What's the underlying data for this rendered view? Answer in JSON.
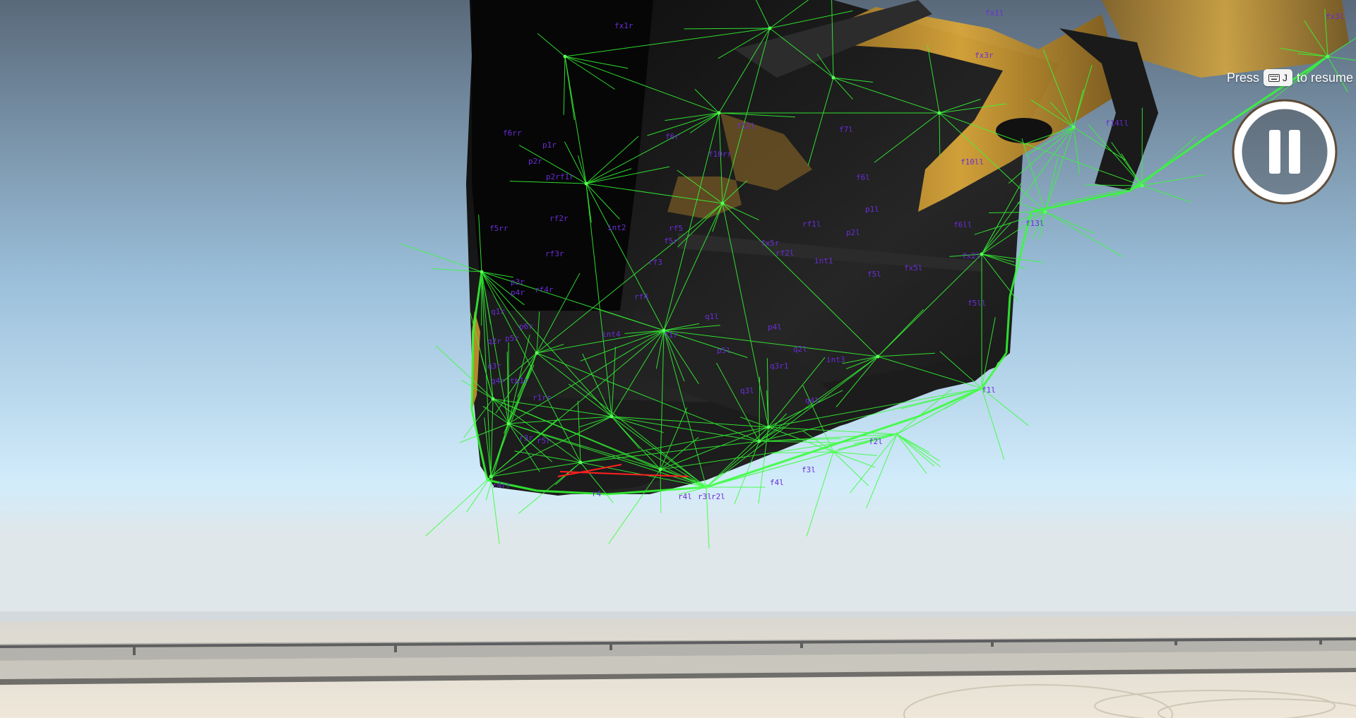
{
  "overlay": {
    "resume_prefix": "Press",
    "resume_key": "J",
    "resume_suffix": "to resume"
  },
  "icons": {
    "pause": "pause-icon",
    "keyboard": "keyboard-icon"
  },
  "colors": {
    "beam_line": "#33ff33",
    "node_label": "#6a2cd8",
    "selected_beam": "#ff2020",
    "vehicle_body": "#141414",
    "vehicle_trim": "#c8952e",
    "sky_top": "#5b6b7c",
    "sky_bottom": "#d3ecfa",
    "ground": "#ece4d6"
  },
  "node_labels": [
    "fx1r",
    "fx3r",
    "f6rr",
    "p1r",
    "p2r",
    "p2rf1r",
    "f5rr",
    "rf2r",
    "int2",
    "rf3r",
    "p3r",
    "p4r",
    "rf4r",
    "q1r",
    "q2r",
    "p5r",
    "p6r",
    "q3r",
    "q4r",
    "tb1r",
    "r1rr",
    "r3r",
    "r5r",
    "r4",
    "r4rr",
    "f6r",
    "f10rr",
    "f5r",
    "rf5",
    "rf3",
    "rf4",
    "int4",
    "f1r",
    "p5l",
    "p4l",
    "q2l",
    "q3l",
    "q4l",
    "int3",
    "f1l",
    "f2l",
    "f3l",
    "f4l",
    "r2l",
    "r3l",
    "r4l",
    "f5l",
    "f6l",
    "p1l",
    "p2l",
    "rf1l",
    "rf2l",
    "int1",
    "fx5l",
    "fx2l",
    "fx1l",
    "fx3l",
    "f10ll",
    "f14ll",
    "f5ll",
    "f6ll",
    "q1l",
    "q3r1",
    "fx5r",
    "f7l",
    "f12l",
    "f13l"
  ]
}
